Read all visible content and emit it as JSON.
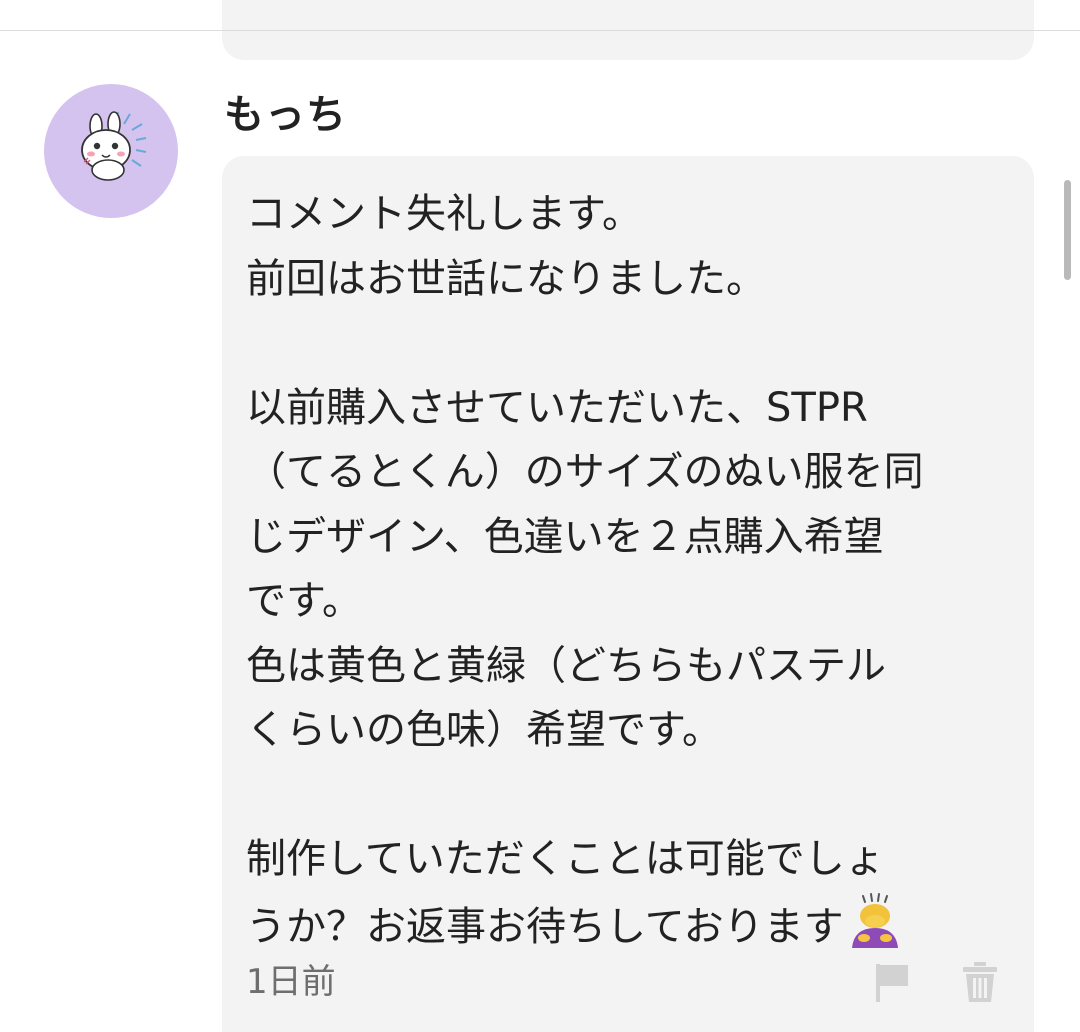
{
  "comment": {
    "username": "もっち",
    "body_lines": [
      "コメント失礼します。",
      "前回はお世話になりました。",
      "",
      "以前購入させていただいた、STPR",
      "（てるとくん）のサイズのぬい服を同",
      "じデザイン、色違いを２点購入希望",
      "です。",
      "色は黄色と黄緑（どちらもパステル",
      "くらいの色味）希望です。",
      "",
      "制作していただくことは可能でしょ",
      "うか？お返事お待ちしております"
    ],
    "emoji_icon": "bowing-person-icon",
    "timestamp": "1日前"
  },
  "icons": {
    "avatar": "rabbit-avatar",
    "flag": "flag-icon",
    "trash": "trash-icon"
  },
  "colors": {
    "avatar_bg": "#d4c3ef",
    "bubble_bg": "#f3f3f3",
    "action_icon": "#d2d2d2"
  }
}
